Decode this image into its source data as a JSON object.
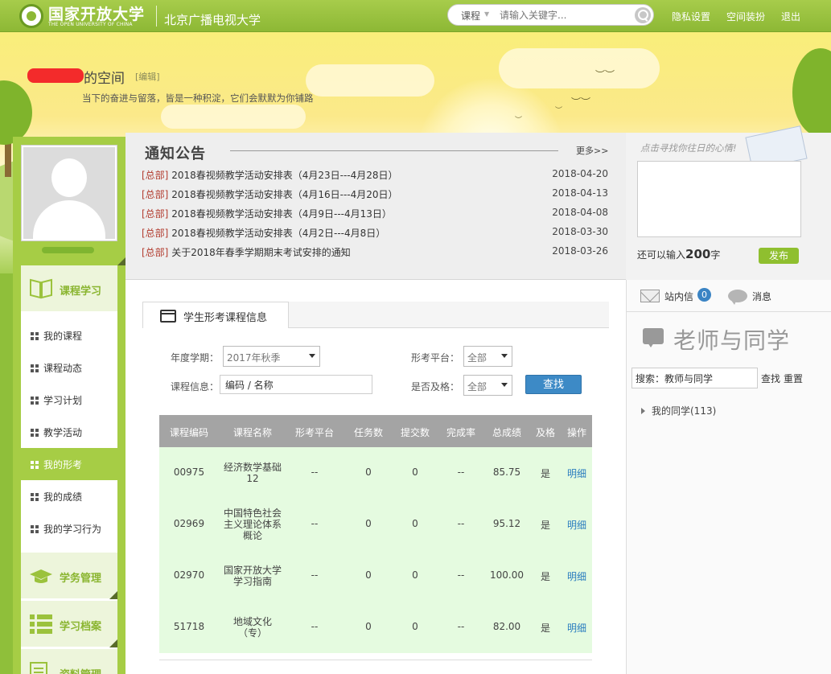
{
  "header": {
    "brand_name": "国家开放大学",
    "brand_sub": "THE OPEN UNIVERSITY OF CHINA",
    "campus": "北京广播电视大学",
    "search": {
      "category": "课程",
      "placeholder": "请输入关键字..."
    },
    "links": [
      "隐私设置",
      "空间装扮",
      "退出"
    ]
  },
  "space": {
    "title_suffix": "的空间",
    "edit_label": "[编辑]",
    "motto": "当下的奋进与留落，皆是一种积淀，它们会默默为你铺路"
  },
  "sidebar": {
    "section_course": "课程学习",
    "items": [
      "我的课程",
      "课程动态",
      "学习计划",
      "教学活动",
      "我的形考",
      "我的成绩",
      "我的学习行为"
    ],
    "active_index": 4,
    "section_affairs": "学务管理",
    "section_archive": "学习档案",
    "section_material": "资料管理"
  },
  "notice": {
    "title": "通知公告",
    "more": "更多>>",
    "rows": [
      {
        "tag": "[总部]",
        "title": "2018春视频教学活动安排表（4月23日---4月28日）",
        "date": "2018-04-20"
      },
      {
        "tag": "[总部]",
        "title": "2018春视频教学活动安排表（4月16日---4月20日）",
        "date": "2018-04-13"
      },
      {
        "tag": "[总部]",
        "title": "2018春视频教学活动安排表（4月9日---4月13日）",
        "date": "2018-04-08"
      },
      {
        "tag": "[总部]",
        "title": "2018春视频教学活动安排表（4月2日---4月8日）",
        "date": "2018-03-30"
      },
      {
        "tag": "[总部]",
        "title": "关于2018年春季学期期末考试安排的通知",
        "date": "2018-03-26"
      }
    ]
  },
  "mood": {
    "title": "点击寻找你往日的心情!",
    "count_prefix": "还可以输入",
    "count_num": "200",
    "count_suffix": "字",
    "post_label": "发布"
  },
  "main": {
    "tab_label": "学生形考课程信息",
    "filters": {
      "term_label": "年度学期：",
      "term_value": "2017年秋季",
      "platform_label": "形考平台：",
      "platform_value": "全部",
      "course_label": "课程信息：",
      "course_value": "编码 / 名称",
      "pass_label": "是否及格：",
      "pass_value": "全部",
      "find_label": "查找"
    },
    "table": {
      "columns": [
        "课程编码",
        "课程名称",
        "形考平台",
        "任务数",
        "提交数",
        "完成率",
        "总成绩",
        "及格",
        "操作"
      ],
      "rows": [
        {
          "code": "00975",
          "name": [
            "经济数学基础",
            "12"
          ],
          "platform": "--",
          "tasks": "0",
          "submitted": "0",
          "rate": "--",
          "score": "85.75",
          "pass": "是",
          "op": "明细"
        },
        {
          "code": "02969",
          "name": [
            "中国特色社会",
            "主义理论体系",
            "概论"
          ],
          "platform": "--",
          "tasks": "0",
          "submitted": "0",
          "rate": "--",
          "score": "95.12",
          "pass": "是",
          "op": "明细"
        },
        {
          "code": "02970",
          "name": [
            "国家开放大学",
            "学习指南"
          ],
          "platform": "--",
          "tasks": "0",
          "submitted": "0",
          "rate": "--",
          "score": "100.00",
          "pass": "是",
          "op": "明细"
        },
        {
          "code": "51718",
          "name": [
            "地域文化",
            "（专）"
          ],
          "platform": "--",
          "tasks": "0",
          "submitted": "0",
          "rate": "--",
          "score": "82.00",
          "pass": "是",
          "op": "明细"
        }
      ]
    }
  },
  "right": {
    "mail_label": "站内信",
    "mail_count": "0",
    "msg_label": "消息",
    "section_title": "老师与同学",
    "search_value": "搜索：教师与同学",
    "search_label": "查找",
    "reset_label": "重置",
    "classmates": "我的同学(113)"
  }
}
